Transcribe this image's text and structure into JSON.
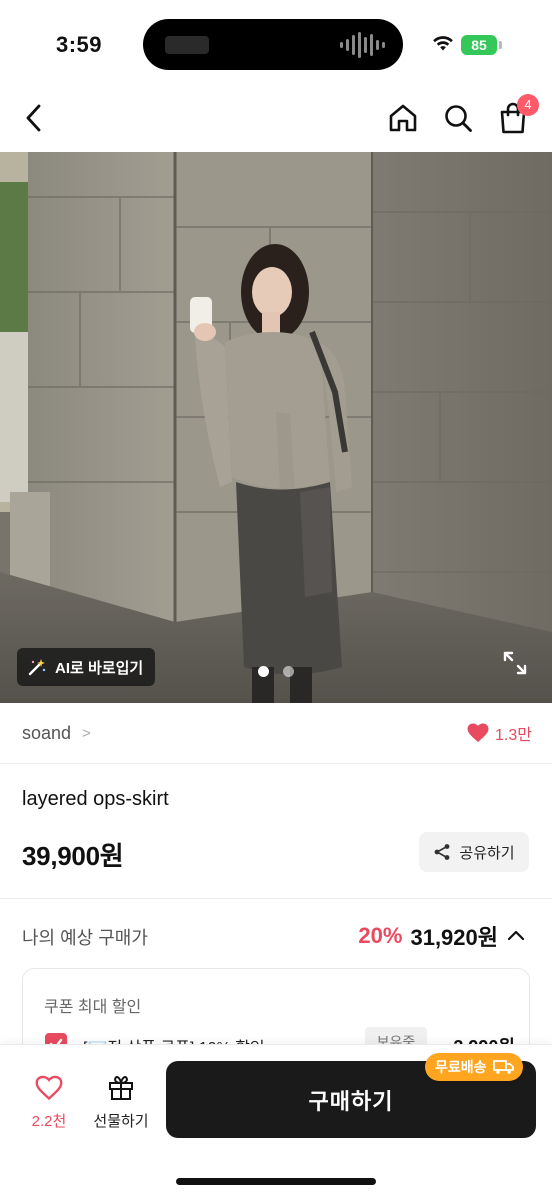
{
  "status_bar": {
    "time": "3:59",
    "battery": "85"
  },
  "nav": {
    "cart_count": "4"
  },
  "product_image": {
    "ai_button_label": "AI로 바로입기",
    "slide_current": 1,
    "slide_total": 2
  },
  "brand": {
    "name": "soand",
    "chevron": ">",
    "likes": "1.3만"
  },
  "product": {
    "name": "layered ops-skirt",
    "price": "39,900원",
    "share_label": "공유하기"
  },
  "estimate": {
    "label": "나의 예상 구매가",
    "discount": "20%",
    "price": "31,920원"
  },
  "coupon": {
    "title": "쿠폰 최대 할인",
    "item_text": "[💌전 상품 쿠폰] 10% 할인",
    "item_tag": "보유중",
    "item_amount": "-3,990원"
  },
  "bottom_bar": {
    "like_count": "2.2천",
    "gift_label": "선물하기",
    "buy_label": "구매하기",
    "free_shipping_label": "무료배송"
  },
  "colors": {
    "accent": "#e84a5f",
    "buy_button": "#1a1a1a",
    "free_shipping": "#ffa51f",
    "battery": "#34c759"
  }
}
